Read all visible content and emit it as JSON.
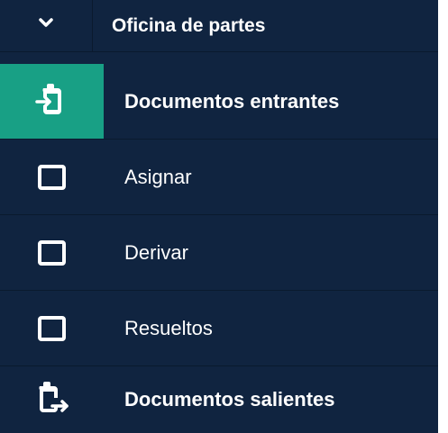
{
  "menu": {
    "header": {
      "label": "Oficina de partes",
      "icon": "chevron-down-icon"
    },
    "items": [
      {
        "label": "Documentos entrantes",
        "icon": "clipboard-import-icon",
        "active": true
      },
      {
        "label": "Asignar",
        "icon": "checkbox-empty-icon"
      },
      {
        "label": "Derivar",
        "icon": "checkbox-empty-icon"
      },
      {
        "label": "Resueltos",
        "icon": "checkbox-empty-icon"
      },
      {
        "label": "Documentos salientes",
        "icon": "clipboard-export-icon"
      }
    ]
  },
  "colors": {
    "background": "#102440",
    "active_accent": "#18a085",
    "text": "#ffffff"
  }
}
